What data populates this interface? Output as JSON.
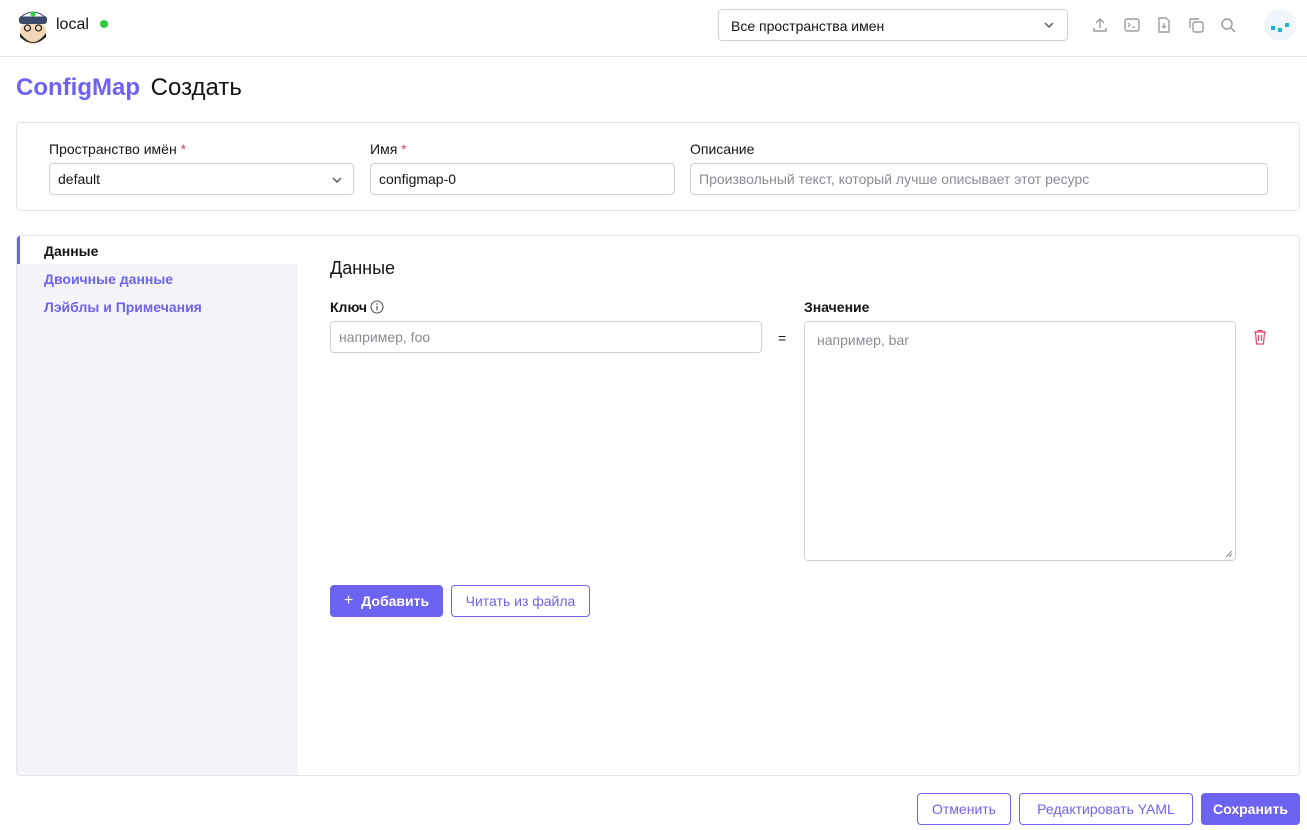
{
  "header": {
    "cluster_name": "local",
    "namespace_select": "Все пространства имен",
    "icons": [
      "upload-icon",
      "terminal-icon",
      "import-icon",
      "copy-icon",
      "search-icon"
    ]
  },
  "page": {
    "resource": "ConfigMap",
    "action": "Создать"
  },
  "meta": {
    "namespace_label": "Пространство имён",
    "namespace_value": "default",
    "name_label": "Имя",
    "name_value": "configmap-0",
    "description_label": "Описание",
    "description_placeholder": "Произвольный текст, который лучше описывает этот ресурс",
    "required_mark": "*"
  },
  "tabs": [
    {
      "label": "Данные",
      "active": true
    },
    {
      "label": "Двоичные данные",
      "active": false
    },
    {
      "label": "Лэйблы и Примечания",
      "active": false
    }
  ],
  "data_section": {
    "title": "Данные",
    "key_label": "Ключ",
    "value_label": "Значение",
    "key_placeholder": "например, foo",
    "value_placeholder": "например, bar",
    "equals": "=",
    "add_button": "Добавить",
    "add_icon": "+",
    "read_file_button": "Читать из файла"
  },
  "footer": {
    "cancel": "Отменить",
    "edit_yaml": "Редактировать YAML",
    "save": "Сохранить"
  },
  "colors": {
    "accent": "#6c63f0",
    "status_ok": "#2ecc40",
    "danger": "#e0466c"
  }
}
